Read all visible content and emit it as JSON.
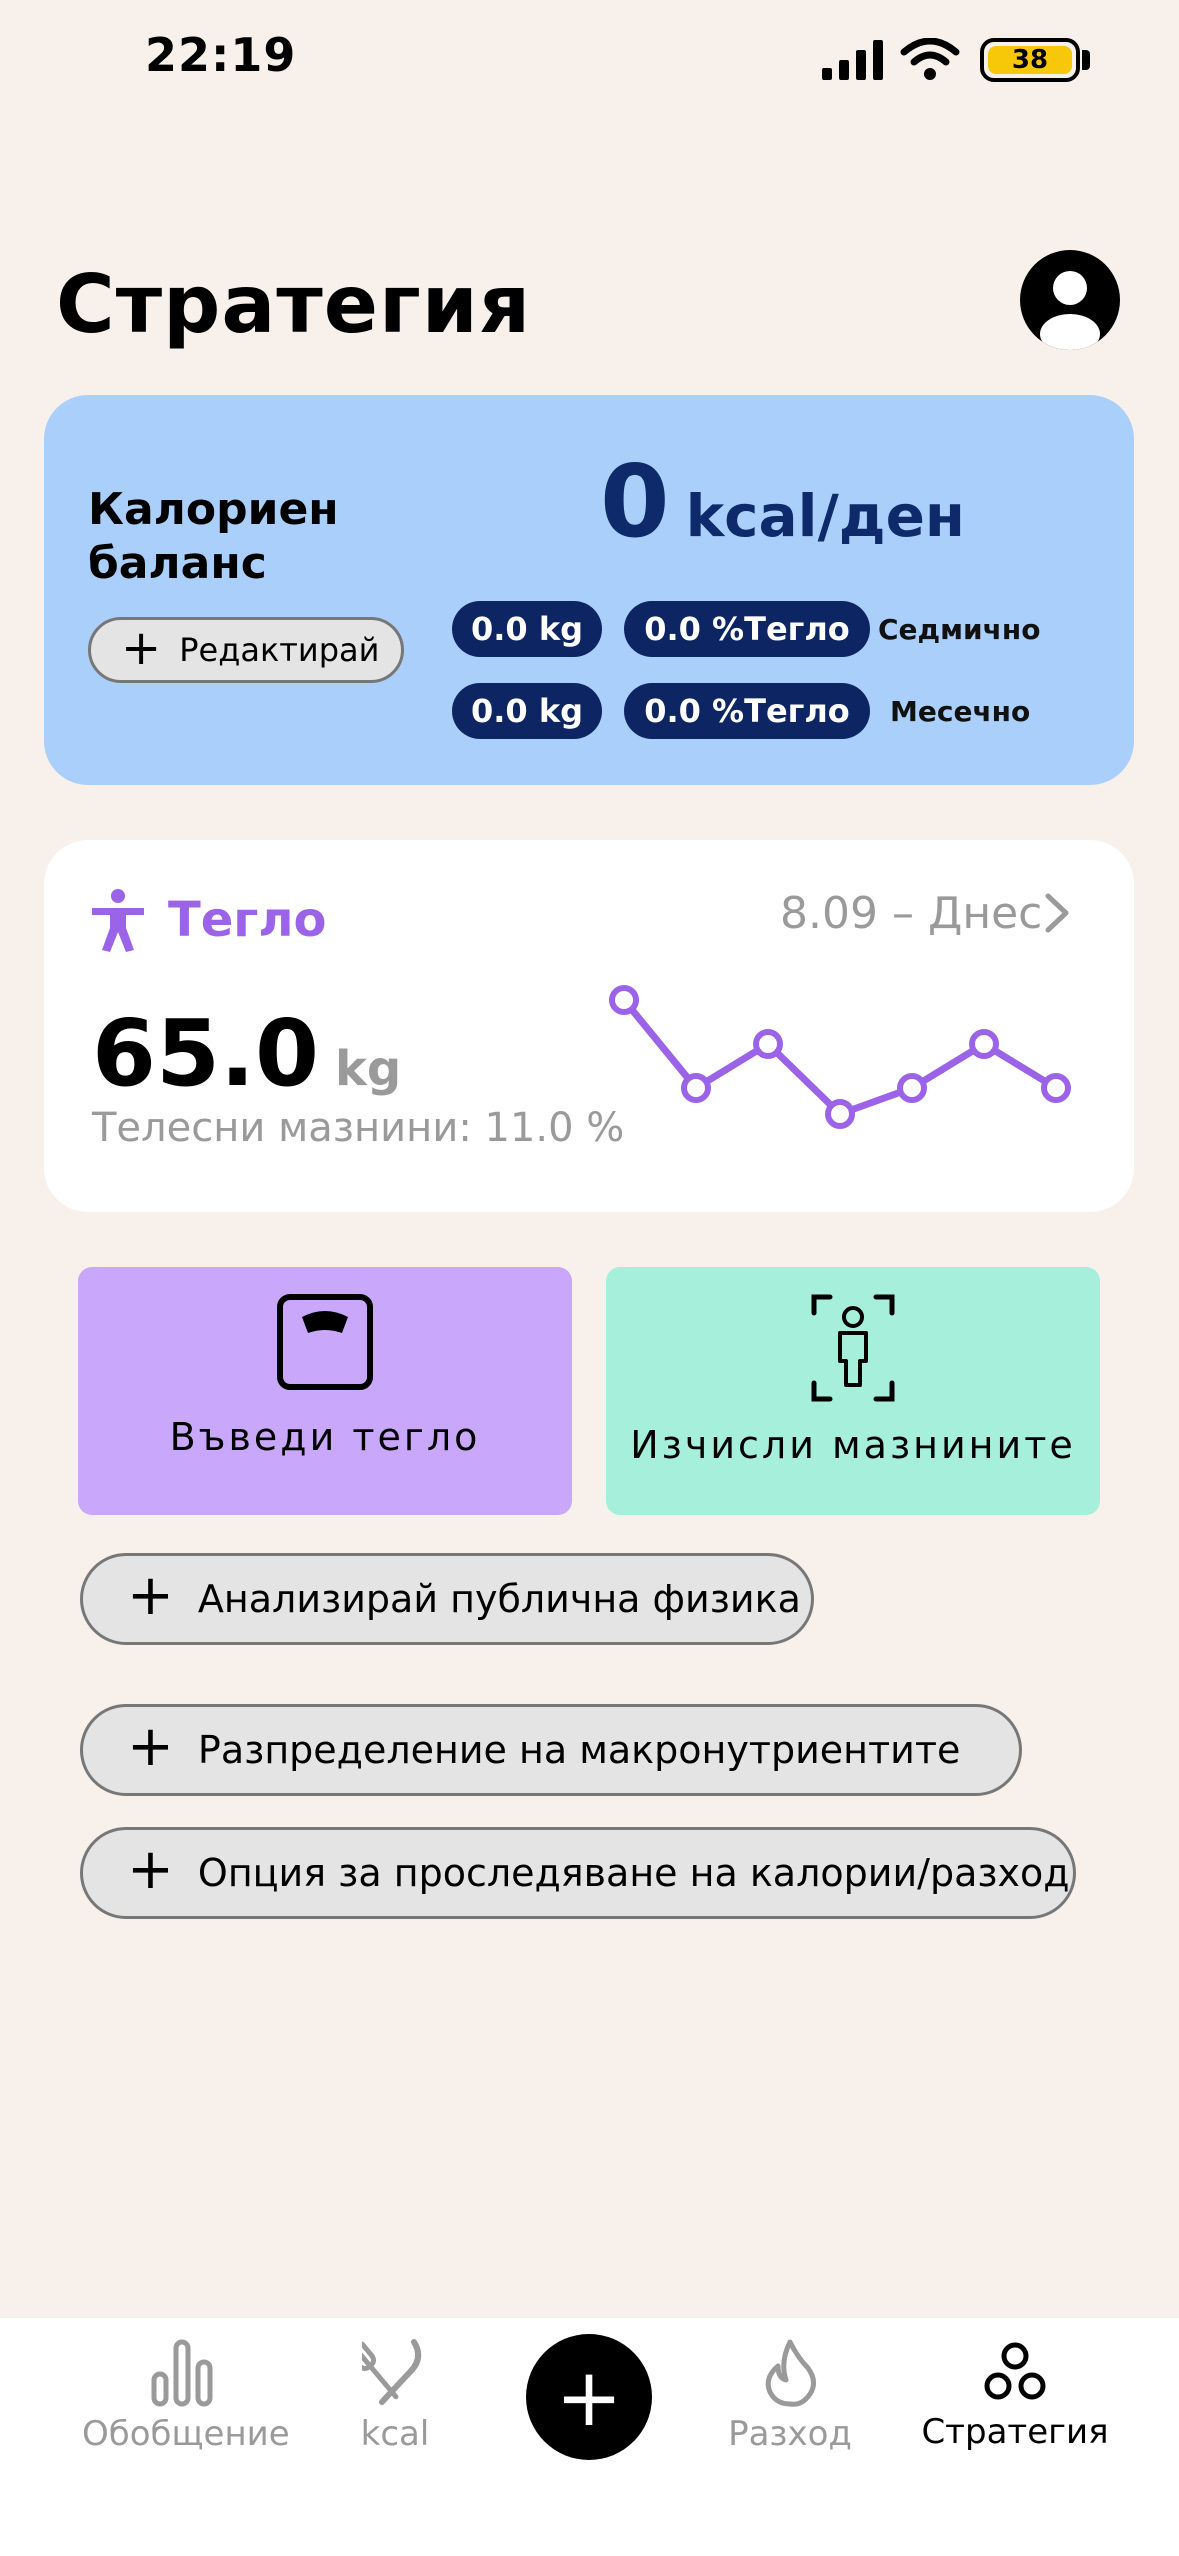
{
  "status_bar": {
    "time": "22:19",
    "battery": "38"
  },
  "header": {
    "title": "Стратегия"
  },
  "calorie_card": {
    "title": "Калориен баланс",
    "edit_label": "Редактирай",
    "value": "0",
    "unit": "kcal/ден",
    "weekly": {
      "kg": "0.0 kg",
      "pct": "0.0 %Тегло",
      "label": "Седмично"
    },
    "monthly": {
      "kg": "0.0 kg",
      "pct": "0.0 %Тегло",
      "label": "Месечно"
    }
  },
  "weight_card": {
    "title": "Тегло",
    "date_range": "8.09 – Днес",
    "value": "65.0",
    "unit": "kg",
    "body_fat": "Телесни мазнини: 11.0 %"
  },
  "actions": {
    "enter_weight": "Въведи тегло",
    "calc_fat": "Изчисли мазнините"
  },
  "buttons": {
    "analyze": "Анализирай публична физика",
    "macros": "Разпределение на макронутриентите",
    "tracking": "Опция за проследяване на калории/разход"
  },
  "nav": {
    "items": [
      {
        "label": "Обобщение",
        "icon": "bar-chart-icon"
      },
      {
        "label": "kcal",
        "icon": "fork-knife-icon"
      },
      {
        "label": "Разход",
        "icon": "flame-icon"
      },
      {
        "label": "Стратегия",
        "icon": "circles-icon"
      }
    ],
    "add_icon": "plus-icon"
  },
  "colors": {
    "background": "#f8f1eb",
    "calorie_card": "#aacffb",
    "pill_dark": "#0e2563",
    "weight_accent": "#9b63e8",
    "tile_purple": "#c9a8fb",
    "tile_mint": "#a6efdb"
  }
}
